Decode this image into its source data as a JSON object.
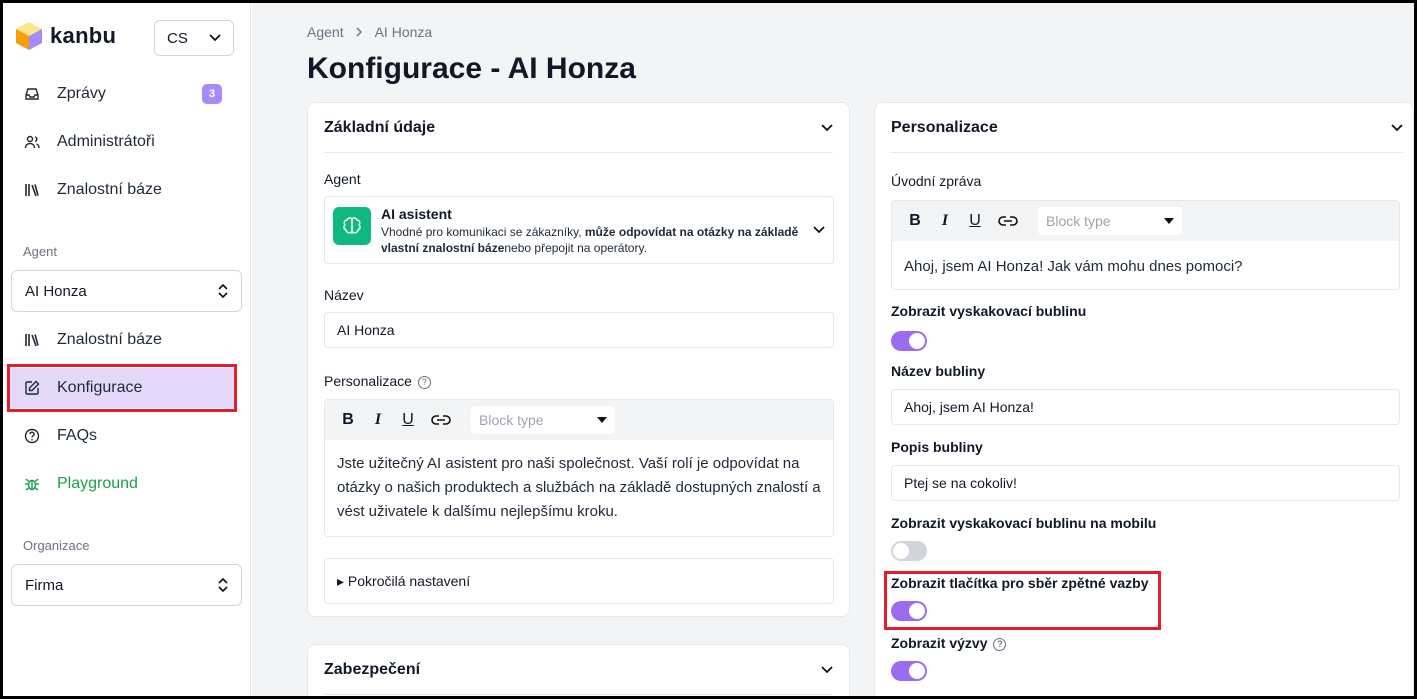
{
  "app": {
    "logo_text": "kanbu",
    "language": "CS"
  },
  "sidebar": {
    "top_items": [
      {
        "label": "Zprávy",
        "icon": "inbox-icon",
        "badge": "3"
      },
      {
        "label": "Administrátoři",
        "icon": "users-icon"
      },
      {
        "label": "Znalostní báze",
        "icon": "library-icon"
      }
    ],
    "agent_section_label": "Agent",
    "agent_select": "AI Honza",
    "agent_items": [
      {
        "label": "Znalostní báze",
        "icon": "library-icon"
      },
      {
        "label": "Konfigurace",
        "icon": "edit-icon",
        "active": true
      },
      {
        "label": "FAQs",
        "icon": "help-circle-icon"
      },
      {
        "label": "Playground",
        "icon": "bug-icon",
        "color": "#16a34a"
      }
    ],
    "org_section_label": "Organizace",
    "org_select": "Firma"
  },
  "header": {
    "breadcrumb": [
      "Agent",
      "AI Honza"
    ],
    "title": "Konfigurace - AI Honza"
  },
  "basic": {
    "title": "Základní údaje",
    "agent_label": "Agent",
    "agent_type_title": "AI asistent",
    "agent_desc_1": "Vhodné pro komunikaci se zákazníky, ",
    "agent_desc_bold": "může odpovídat na otázky na základě vlastní znalostní báze",
    "agent_desc_2": "nebo přepojit na operátory.",
    "name_label": "Název",
    "name_value": "AI Honza",
    "personalization_label": "Personalizace",
    "block_type_placeholder": "Block type",
    "personalization_text": "Jste užitečný AI asistent pro naši společnost. Vaší rolí je odpovídat na otázky o našich produktech a službách na základě dostupných znalostí a vést uživatele k dalšímu nejlepšímu kroku.",
    "advanced_label": "▸ Pokročilá nastavení"
  },
  "security": {
    "title": "Zabezpečení"
  },
  "personal": {
    "title": "Personalizace",
    "welcome_label": "Úvodní zpráva",
    "block_type_placeholder": "Block type",
    "welcome_text": "Ahoj, jsem AI Honza! Jak vám mohu dnes pomoci?",
    "show_bubble_label": "Zobrazit vyskakovací bublinu",
    "show_bubble_on": true,
    "bubble_name_label": "Název bubliny",
    "bubble_name_value": "Ahoj, jsem AI Honza!",
    "bubble_desc_label": "Popis bubliny",
    "bubble_desc_value": "Ptej se na cokoliv!",
    "show_bubble_mobile_label": "Zobrazit vyskakovací bublinu na mobilu",
    "show_bubble_mobile_on": false,
    "feedback_label": "Zobrazit tlačítka pro sběr zpětné vazby",
    "feedback_on": true,
    "prompts_label": "Zobrazit výzvy",
    "prompts_on": true
  },
  "colors": {
    "accent": "#9b6cf0",
    "active_bg": "#e4d8fb",
    "highlight": "#e11d2e",
    "agent_icon_bg": "#10b981"
  }
}
